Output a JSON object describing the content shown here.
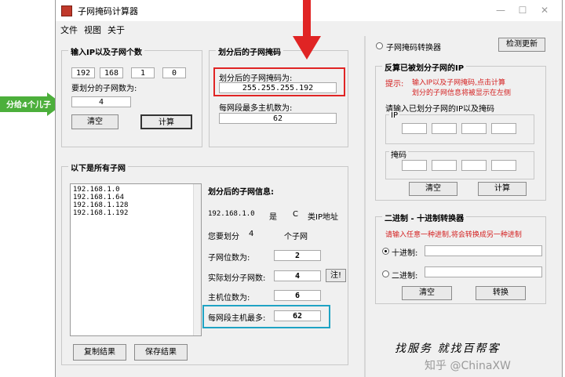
{
  "window": {
    "title": "子网掩码计算器"
  },
  "menu": [
    "文件",
    "视图",
    "关于"
  ],
  "input_group": {
    "title": "输入IP以及子网个数",
    "ip": [
      "192",
      "168",
      "1",
      "0"
    ],
    "subnet_count_label": "要划分的子网数为:",
    "subnet_count": "4",
    "clear_label": "清空",
    "calc_label": "计算"
  },
  "mask_group": {
    "title": "划分后的子网掩码",
    "mask_label": "划分后的子网掩码为:",
    "mask_value": "255.255.255.192",
    "hosts_label": "每网段最多主机数为:",
    "hosts_value": "62"
  },
  "subnets_group": {
    "title": "以下是所有子网",
    "list": [
      "192.168.1.0",
      "192.168.1.64",
      "192.168.1.128",
      "192.168.1.192"
    ],
    "copy_label": "复制结果",
    "save_label": "保存结果"
  },
  "info": {
    "title": "划分后的子网信息:",
    "ip": "192.168.1.0",
    "is": "是",
    "class": "C",
    "class_suffix": "类IP地址",
    "div_prefix": "您要划分",
    "div_count": "4",
    "div_suffix": "个子网",
    "subnet_bits_label": "子网位数为:",
    "subnet_bits": "2",
    "actual_label": "实际划分子网数:",
    "actual": "4",
    "note_label": "注!",
    "host_bits_label": "主机位数为:",
    "host_bits": "6",
    "max_hosts_label": "每网段主机最多:",
    "max_hosts": "62"
  },
  "right": {
    "mask_converter_label": "子网掩码转换器",
    "check_update_label": "检测更新",
    "reverse_title": "反算已被划分子网的IP",
    "hint_prefix": "提示:",
    "hint1": "输入IP以及子网掩码,点击计算",
    "hint2": "划分的子网信息将被显示在左侧",
    "enter_label": "请输入已划分子网的IP以及掩码",
    "ip_label": "IP",
    "mask_label": "掩码",
    "clear_label": "清空",
    "calc_label": "计算",
    "binary_title": "二进制 - 十进制转换器",
    "binary_hint": "请输入任意一种进制,将会转换成另一种进制",
    "decimal_label": "十进制:",
    "binary_label": "二进制:",
    "clear2_label": "清空",
    "convert_label": "转换"
  },
  "annotation": {
    "left_label": "分给4个儿子",
    "signature": "找服务 就找百帮客",
    "watermark": "知乎 @ChinaXW"
  },
  "colors": {
    "red": "#e02424",
    "green": "#4caf3b",
    "blue": "#1fa3c4"
  }
}
